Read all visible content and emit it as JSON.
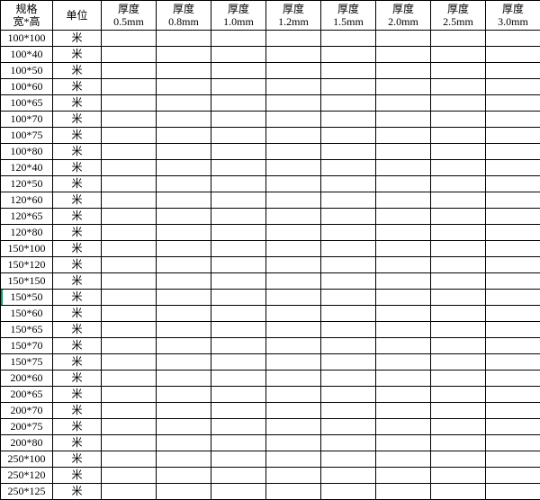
{
  "headers": {
    "spec": {
      "line1": "规格",
      "line2": "宽*高"
    },
    "unit": "单位",
    "thickness_label": "厚度",
    "thickness_values": [
      "0.5mm",
      "0.8mm",
      "1.0mm",
      "1.2mm",
      "1.5mm",
      "2.0mm",
      "2.5mm",
      "3.0mm"
    ]
  },
  "unit_value": "米",
  "rows": [
    {
      "spec": "100*100"
    },
    {
      "spec": "100*40"
    },
    {
      "spec": "100*50"
    },
    {
      "spec": "100*60"
    },
    {
      "spec": "100*65"
    },
    {
      "spec": "100*70"
    },
    {
      "spec": "100*75"
    },
    {
      "spec": "100*80"
    },
    {
      "spec": "120*40"
    },
    {
      "spec": "120*50"
    },
    {
      "spec": "120*60"
    },
    {
      "spec": "120*65"
    },
    {
      "spec": "120*80"
    },
    {
      "spec": "150*100"
    },
    {
      "spec": "150*120"
    },
    {
      "spec": "150*150"
    },
    {
      "spec": "150*50",
      "highlight": true
    },
    {
      "spec": "150*60"
    },
    {
      "spec": "150*65"
    },
    {
      "spec": "150*70"
    },
    {
      "spec": "150*75"
    },
    {
      "spec": "200*60"
    },
    {
      "spec": "200*65"
    },
    {
      "spec": "200*70"
    },
    {
      "spec": "200*75"
    },
    {
      "spec": "200*80"
    },
    {
      "spec": "250*100"
    },
    {
      "spec": "250*120"
    },
    {
      "spec": "250*125"
    }
  ]
}
